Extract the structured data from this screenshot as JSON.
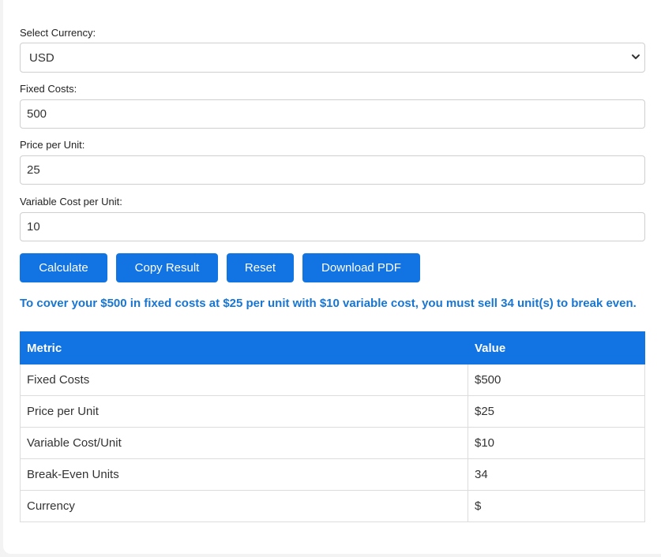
{
  "form": {
    "currency": {
      "label": "Select Currency:",
      "value": "USD"
    },
    "fixed_costs": {
      "label": "Fixed Costs:",
      "value": "500"
    },
    "price_per_unit": {
      "label": "Price per Unit:",
      "value": "25"
    },
    "variable_cost": {
      "label": "Variable Cost per Unit:",
      "value": "10"
    }
  },
  "buttons": {
    "calculate": "Calculate",
    "copy": "Copy Result",
    "reset": "Reset",
    "download": "Download PDF"
  },
  "result_text": "To cover your $500 in fixed costs at $25 per unit with $10 variable cost, you must sell 34 unit(s) to break even.",
  "table": {
    "headers": [
      "Metric",
      "Value"
    ],
    "rows": [
      [
        "Fixed Costs",
        "$500"
      ],
      [
        "Price per Unit",
        "$25"
      ],
      [
        "Variable Cost/Unit",
        "$10"
      ],
      [
        "Break-Even Units",
        "34"
      ],
      [
        "Currency",
        "$"
      ]
    ]
  },
  "colors": {
    "accent": "#1274e2",
    "result_text": "#1776d4"
  }
}
